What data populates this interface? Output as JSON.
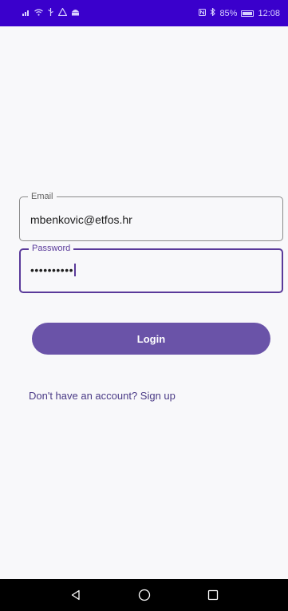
{
  "status_bar": {
    "left_icons": [
      "signal-icon",
      "wifi-icon",
      "usb-icon",
      "alert-icon",
      "android-icon"
    ],
    "battery": "85%",
    "time": "12:08"
  },
  "form": {
    "email": {
      "label": "Email",
      "value": "mbenkovic@etfos.hr"
    },
    "password": {
      "label": "Password",
      "value": "••••••••••"
    }
  },
  "login_label": "Login",
  "signup_text": "Don't have an account? Sign up",
  "colors": {
    "status_bar": "#3a00cc",
    "accent": "#6a53a8",
    "focused_border": "#5a3a9a",
    "background": "#f8f8fa",
    "nav_bar": "#000000"
  },
  "nav_bar": {
    "icons": [
      "back-icon",
      "home-icon",
      "recents-icon"
    ]
  }
}
